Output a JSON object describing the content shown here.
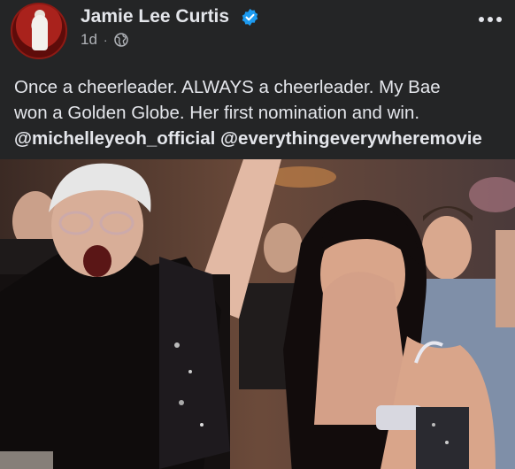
{
  "post": {
    "author": "Jamie Lee Curtis",
    "timestamp": "1d",
    "separator": "·",
    "caption_lines": [
      "Once a cheerleader. ALWAYS a cheerleader. My Bae",
      "won a Golden Globe. Her first nomination and win."
    ],
    "mentions": [
      "@michelleyeoh_official",
      "@everythingeverywheremovie"
    ]
  },
  "icons": {
    "verified": "verified-badge-icon",
    "audience": "globe-icon",
    "more": "more-options-icon"
  },
  "colors": {
    "background": "#242526",
    "text_primary": "#e4e6eb",
    "text_secondary": "#b0b3b8",
    "verified_blue": "#1d9bf0"
  }
}
